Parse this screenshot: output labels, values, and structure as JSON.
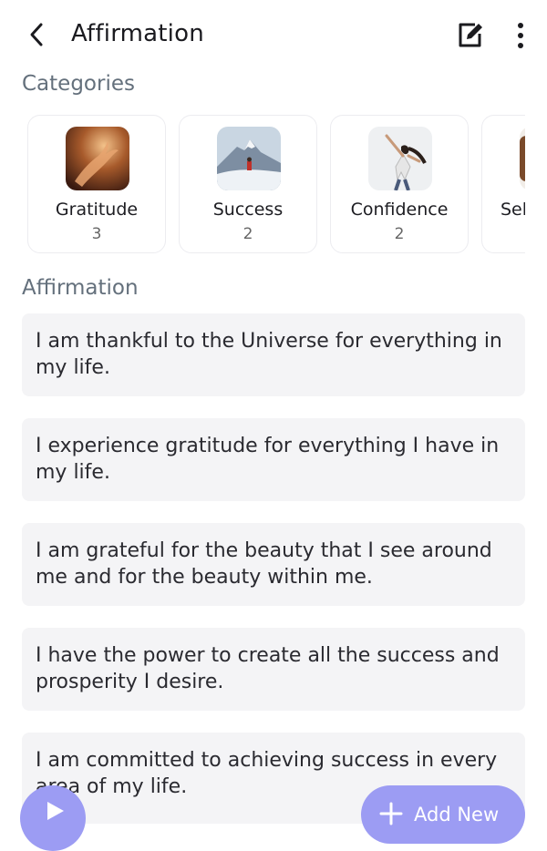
{
  "header": {
    "title": "Affirmation",
    "back_icon": "chevron-left-icon",
    "edit_icon": "edit-note-icon",
    "more_icon": "more-vertical-icon"
  },
  "categories": {
    "title": "Categories",
    "items": [
      {
        "name": "Gratitude",
        "count": "3",
        "image": "hand-in-warm-light"
      },
      {
        "name": "Success",
        "count": "2",
        "image": "person-on-snowy-mountain"
      },
      {
        "name": "Confidence",
        "count": "2",
        "image": "woman-jumping-joyfully"
      },
      {
        "name": "Sel",
        "count": "",
        "image": "partial-category-image"
      }
    ]
  },
  "affirmations": {
    "title": "Affirmation",
    "items": [
      "I am thankful to the Universe for everything in my life.",
      "I experience gratitude for everything I have in my life.",
      "I am grateful for the beauty that I see around me and for the beauty within me.",
      "I have the power to create all the success and prosperity I desire.",
      "I am committed to achieving success in every area of my life."
    ]
  },
  "fab": {
    "play_icon": "play-icon",
    "add_label": "Add New",
    "add_icon": "plus-icon"
  },
  "colors": {
    "accent": "#9c9cf3",
    "card_bg": "#f4f4f6",
    "section_title": "#64707c"
  }
}
